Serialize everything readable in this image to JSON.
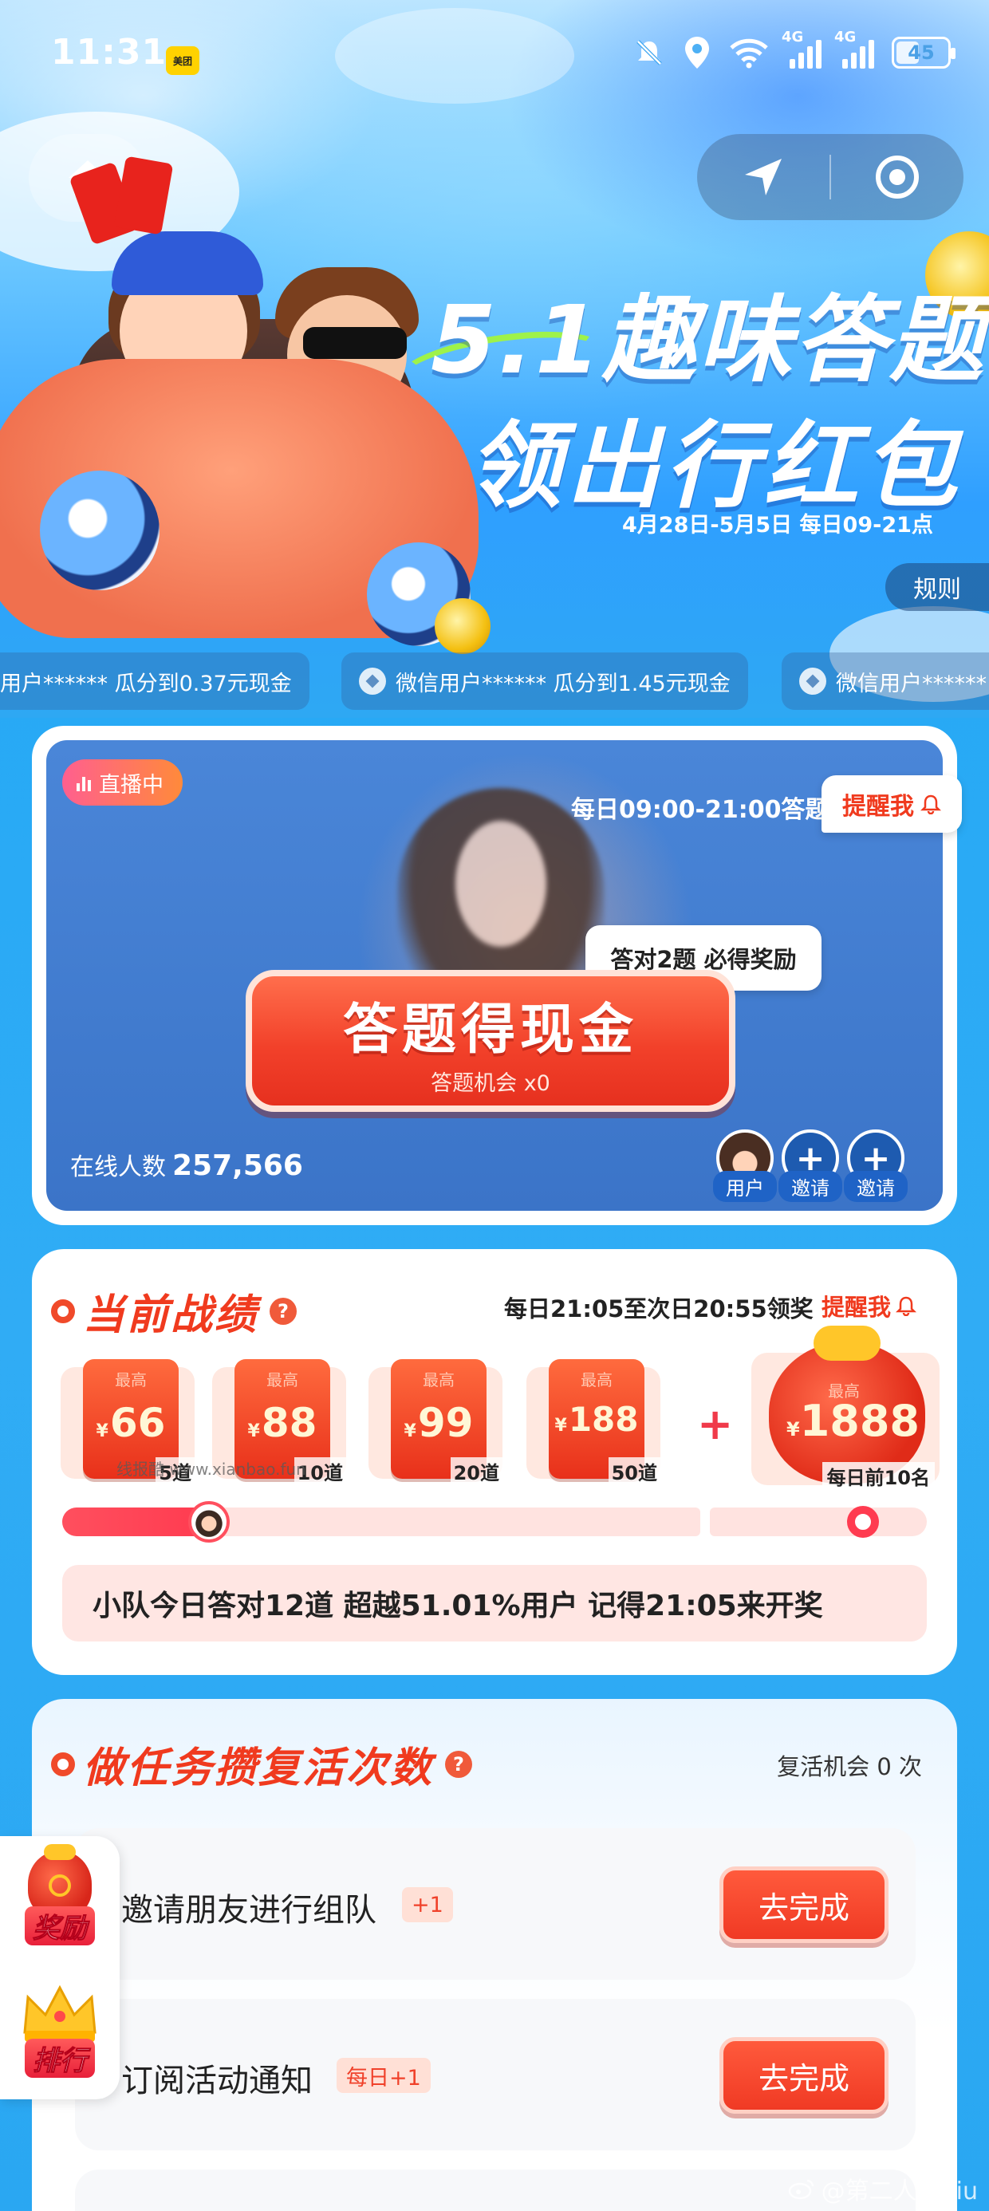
{
  "status_bar": {
    "time": "11:31",
    "app_badge": "美团",
    "net1": "4G",
    "net2": "4G",
    "battery": "45",
    "battery_level": 0.45
  },
  "hero": {
    "title_line1": "5.1趣味答题",
    "title_line2": "领出行红包",
    "date_range": "4月28日-5月5日 每日09-21点",
    "rules_label": "规则"
  },
  "ticker": [
    "用户****** 瓜分到0.37元现金",
    "微信用户****** 瓜分到1.45元现金",
    "微信用户******"
  ],
  "live": {
    "badge": "直播中",
    "answer_time": "每日09:00-21:00答题",
    "remind_label": "提醒我",
    "tip": "答对2题 必得奖励",
    "cash_button": "答题得现金",
    "chances": "答题机会 x0",
    "online_label": "在线人数",
    "online_count": "257,566",
    "avatars": [
      {
        "label": "用户",
        "glyph": ""
      },
      {
        "label": "邀请",
        "glyph": "+"
      },
      {
        "label": "邀请",
        "glyph": "+"
      }
    ]
  },
  "score": {
    "title": "当前战绩",
    "help": "?",
    "prize_time": "每日21:05至次日20:55领奖",
    "remind_label": "提醒我",
    "envelopes": [
      {
        "top": "最高",
        "currency": "¥",
        "amount": "66",
        "tag": "5道"
      },
      {
        "top": "最高",
        "currency": "¥",
        "amount": "88",
        "tag": "10道"
      },
      {
        "top": "最高",
        "currency": "¥",
        "amount": "99",
        "tag": "20道"
      },
      {
        "top": "最高",
        "currency": "¥",
        "amount": "188",
        "tag": "50道"
      }
    ],
    "plus": "+",
    "bag": {
      "top": "最高",
      "currency": "¥",
      "amount": "1888",
      "tag": "每日前10名"
    },
    "watermark": "线报酷 www.xianbao.fun",
    "progress_fraction": 0.23,
    "summary": "小队今日答对12道 超越51.01%用户 记得21:05来开奖"
  },
  "tasks": {
    "title": "做任务攒复活次数",
    "help": "?",
    "revive": "复活机会 0 次",
    "items": [
      {
        "name": "邀请朋友进行组队",
        "bonus": "+1",
        "button": "去完成"
      },
      {
        "name": "订阅活动通知",
        "bonus": "每日+1",
        "button": "去完成"
      }
    ]
  },
  "side": {
    "reward_label": "奖励",
    "rank_label": "排行"
  },
  "weibo_watermark": "@第二人生biu",
  "colors": {
    "accent_red": "#f03a1e",
    "sky_blue": "#2ea8f3",
    "live_blue": "#3b74c8"
  }
}
